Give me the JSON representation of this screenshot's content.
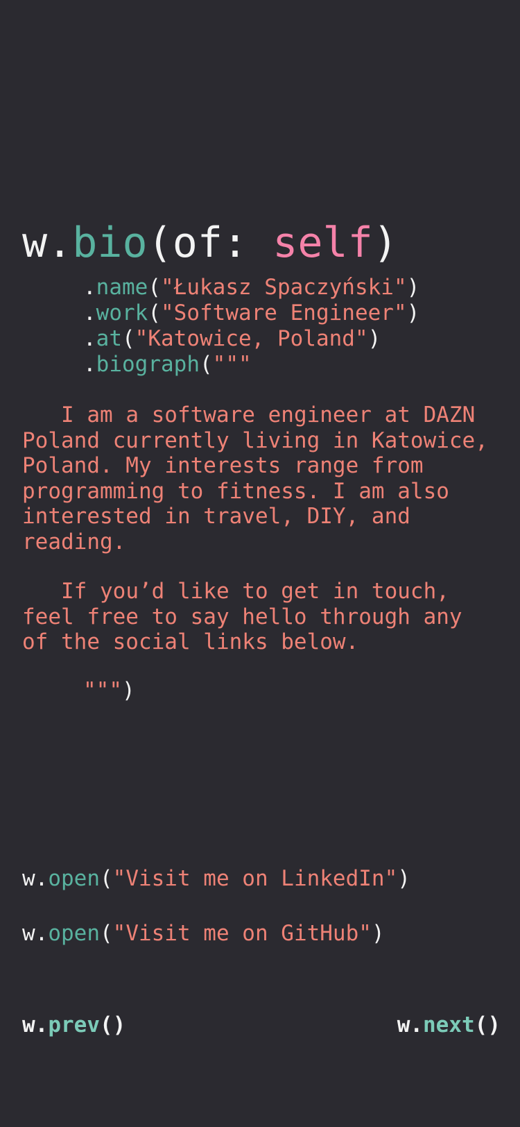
{
  "colors": {
    "background": "#2b2a30",
    "text": "#f3f3f3",
    "function": "#59b29f",
    "string": "#ee8276",
    "keyword": "#f582a9"
  },
  "header": {
    "object": "w.",
    "method": "bio",
    "open_paren": "(",
    "param": "of: ",
    "keyword": "self",
    "close_paren": ")"
  },
  "chain": [
    {
      "dot": ".",
      "method": "name",
      "open": "(",
      "arg": "\"Łukasz Spaczyński\"",
      "close": ")"
    },
    {
      "dot": ".",
      "method": "work",
      "open": "(",
      "arg": "\"Software Engineer\"",
      "close": ")"
    },
    {
      "dot": ".",
      "method": "at",
      "open": "(",
      "arg": "\"Katowice, Poland\"",
      "close": ")"
    },
    {
      "dot": ".",
      "method": "biograph",
      "open": "(",
      "arg": "\"\"\"",
      "close": ""
    }
  ],
  "biography": {
    "paragraph1": "   I am a software engineer at DAZN Poland currently living in Katowice, Poland. My interests range from programming to fitness. I am also interested in travel, DIY, and reading.",
    "paragraph2": "   If you’d like to get in touch, feel free to say hello through any of the social links below.",
    "closing_quotes": "\"\"\"",
    "closing_paren": ")"
  },
  "links": [
    {
      "object": "w.",
      "method": "open",
      "open": "(",
      "label": "\"Visit me on LinkedIn\"",
      "close": ")"
    },
    {
      "object": "w.",
      "method": "open",
      "open": "(",
      "label": "\"Visit me on GitHub\"",
      "close": ")"
    }
  ],
  "navigation": {
    "prev": {
      "object": "w.",
      "method": "prev",
      "parens": "()"
    },
    "next": {
      "object": "w.",
      "method": "next",
      "parens": "()"
    }
  }
}
